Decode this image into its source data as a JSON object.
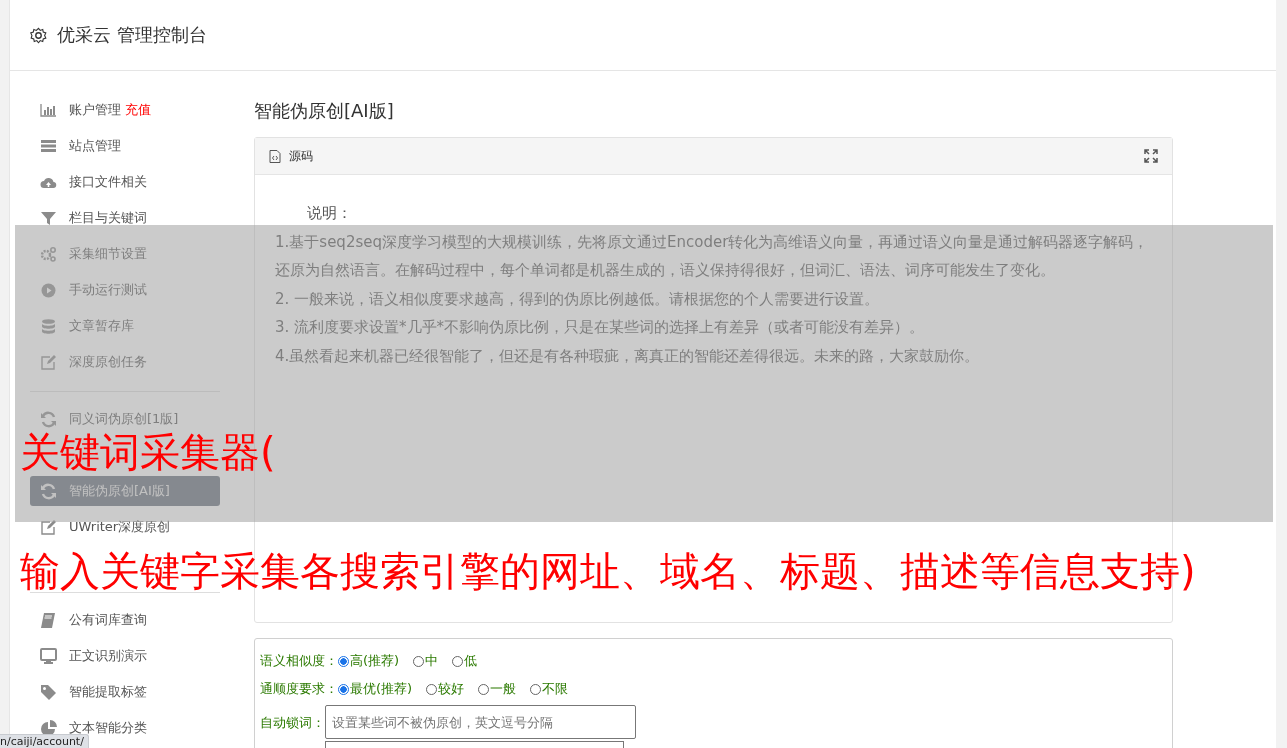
{
  "header": {
    "title": "优采云 管理控制台"
  },
  "sidebar": {
    "groups": [
      {
        "items": [
          {
            "kind": "bars",
            "label": "账户管理",
            "badge": "充值",
            "selected": false
          },
          {
            "kind": "server",
            "label": "站点管理",
            "selected": false
          },
          {
            "kind": "cloud",
            "label": "接口文件相关",
            "selected": false
          },
          {
            "kind": "filter",
            "label": "栏目与关键词",
            "selected": false
          },
          {
            "kind": "gears",
            "label": "采集细节设置",
            "selected": false
          },
          {
            "kind": "play",
            "label": "手动运行测试",
            "selected": false
          },
          {
            "kind": "db",
            "label": "文章暂存库",
            "selected": false
          },
          {
            "kind": "edit",
            "label": "深度原创任务",
            "selected": false
          }
        ]
      },
      {
        "items": [
          {
            "kind": "refresh",
            "label": "同义词伪原创[1版]",
            "selected": false
          },
          {
            "kind": "refresh",
            "label": "智能伪原创[AI版]",
            "selected": true
          },
          {
            "kind": "edit",
            "label": "UWriter深度原创",
            "selected": false
          }
        ]
      },
      {
        "items": [
          {
            "kind": "book",
            "label": "公有词库查询",
            "selected": false
          },
          {
            "kind": "monitor",
            "label": "正文识别演示",
            "selected": false
          },
          {
            "kind": "tag",
            "label": "智能提取标签",
            "selected": false
          },
          {
            "kind": "pie",
            "label": "文本智能分类",
            "selected": false
          }
        ]
      }
    ]
  },
  "main": {
    "title": "智能伪原创[AI版]",
    "panel": {
      "tab": "源码",
      "heading": "说明：",
      "lines": [
        "1.基于seq2seq深度学习模型的大规模训练，先将原文通过Encoder转化为高维语义向量，再通过语义向量是通过解码器逐字解码，还原为自然语言。在解码过程中，每个单词都是机器生成的，语义保持得很好，但词汇、语法、词序可能发生了变化。",
        "2. 一般来说，语义相似度要求越高，得到的伪原比例越低。请根据您的个人需要进行设置。",
        "3. 流利度要求设置*几乎*不影响伪原比例，只是在某些词的选择上有差异（或者可能没有差异）。",
        "4.虽然看起来机器已经很智能了，但还是有各种瑕疵，离真正的智能还差得很远。未来的路，大家鼓励你。"
      ]
    },
    "form": {
      "radio_groups": [
        {
          "label": "语义相似度：",
          "options": [
            {
              "label": "高(推荐)",
              "selected": true
            },
            {
              "label": "中",
              "selected": false
            },
            {
              "label": "低",
              "selected": false
            }
          ]
        },
        {
          "label": "通顺度要求：",
          "options": [
            {
              "label": "最优(推荐)",
              "selected": true
            },
            {
              "label": "较好",
              "selected": false
            },
            {
              "label": "一般",
              "selected": false
            },
            {
              "label": "不限",
              "selected": false
            }
          ]
        }
      ],
      "lock": {
        "label": "自动锁词：",
        "placeholder": "设置某些词不被伪原创，英文逗号分隔"
      }
    }
  },
  "overlay": {
    "title": "关键词采集器(",
    "text": "输入关键字采集各搜索引擎的网址、域名、标题、描述等信息支持)"
  },
  "status_bar": {
    "url": "n/caiji/account/"
  }
}
